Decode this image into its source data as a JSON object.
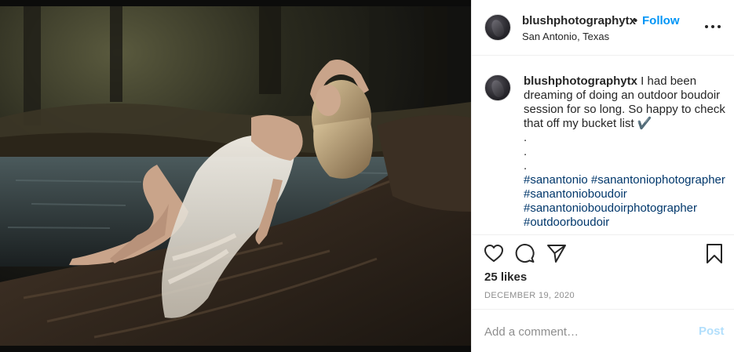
{
  "post": {
    "image": {
      "description_icon": "photo",
      "colors": {
        "background": "#1b1a14",
        "water": "#2f3a3e",
        "log": "#3a2e22",
        "dress": "#e8e2d6",
        "skin": "#c9a48a",
        "hair": "#b89a6e"
      }
    },
    "header": {
      "username": "blushphotographytx",
      "separator": "•",
      "follow_label": "Follow",
      "location": "San Antonio, Texas",
      "more_icon": "more-options-icon"
    },
    "caption": {
      "username": "blushphotographytx",
      "text": "I had been dreaming of doing an outdoor boudoir session for so long. So happy to check that off my bucket list ✔️",
      "dots": [
        ".",
        ".",
        "."
      ],
      "hashtags": [
        "#sanantonio #sanantoniophotographer",
        "#sanantonioboudoir",
        "#sanantonioboudoirphotographer",
        "#outdoorboudoir"
      ]
    },
    "actions": {
      "like_icon": "heart-icon",
      "comment_icon": "comment-icon",
      "share_icon": "send-icon",
      "save_icon": "bookmark-icon"
    },
    "likes": "25 likes",
    "date": "DECEMBER 19, 2020",
    "comment": {
      "placeholder": "Add a comment…",
      "value": "",
      "post_label": "Post"
    },
    "colors": {
      "accent": "#0095f6",
      "hashtag": "#00376b",
      "muted": "#8e8e8e",
      "post_disabled": "#b2dffc"
    }
  }
}
